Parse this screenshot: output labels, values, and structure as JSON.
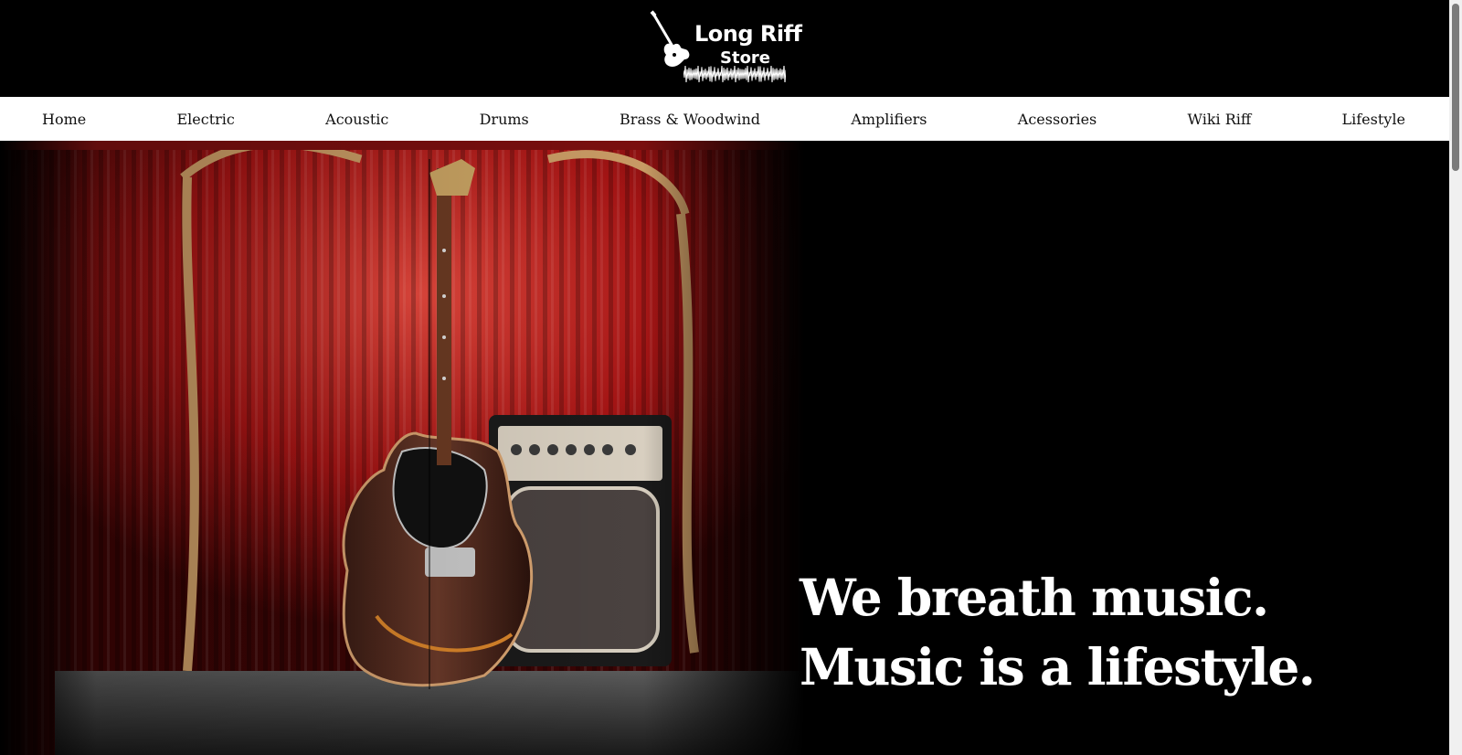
{
  "logo": {
    "title": "Long Riff",
    "subtitle": "Store",
    "icon": "electric-guitar-icon"
  },
  "nav": {
    "items": [
      {
        "label": "Home"
      },
      {
        "label": "Electric"
      },
      {
        "label": "Acoustic"
      },
      {
        "label": "Drums"
      },
      {
        "label": "Brass & Woodwind"
      },
      {
        "label": "Amplifiers"
      },
      {
        "label": "Acessories"
      },
      {
        "label": "Wiki Riff"
      },
      {
        "label": "Lifestyle"
      }
    ]
  },
  "hero": {
    "line1": "We breath music.",
    "line2": "Music is a lifestyle.",
    "image": "guitar-and-amplifier-on-stage-with-red-curtain"
  },
  "colors": {
    "background": "#000000",
    "nav_background": "#ffffff",
    "curtain": "#b01818",
    "text_light": "#ffffff"
  }
}
